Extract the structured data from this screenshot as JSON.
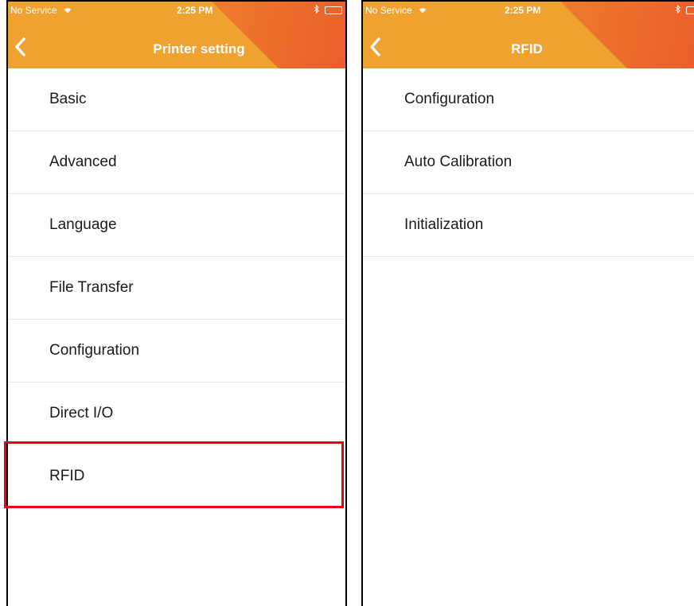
{
  "screens": [
    {
      "status_bar": {
        "carrier": "No Service",
        "time": "2:25 PM"
      },
      "nav": {
        "title": "Printer setting"
      },
      "menu": [
        {
          "label": "Basic"
        },
        {
          "label": "Advanced"
        },
        {
          "label": "Language"
        },
        {
          "label": "File Transfer"
        },
        {
          "label": "Configuration"
        },
        {
          "label": "Direct I/O"
        },
        {
          "label": "RFID"
        }
      ],
      "highlighted_item": "RFID"
    },
    {
      "status_bar": {
        "carrier": "No Service",
        "time": "2:25 PM"
      },
      "nav": {
        "title": "RFID"
      },
      "menu": [
        {
          "label": "Configuration"
        },
        {
          "label": "Auto Calibration"
        },
        {
          "label": "Initialization"
        }
      ]
    }
  ],
  "colors": {
    "header_primary": "#f0a230",
    "header_accent": "#ec6e2c",
    "highlight_border": "#e60012",
    "divider": "#e7e7e7"
  },
  "icons": [
    "back-chevron-icon",
    "wifi-icon",
    "bluetooth-icon",
    "battery-icon"
  ]
}
